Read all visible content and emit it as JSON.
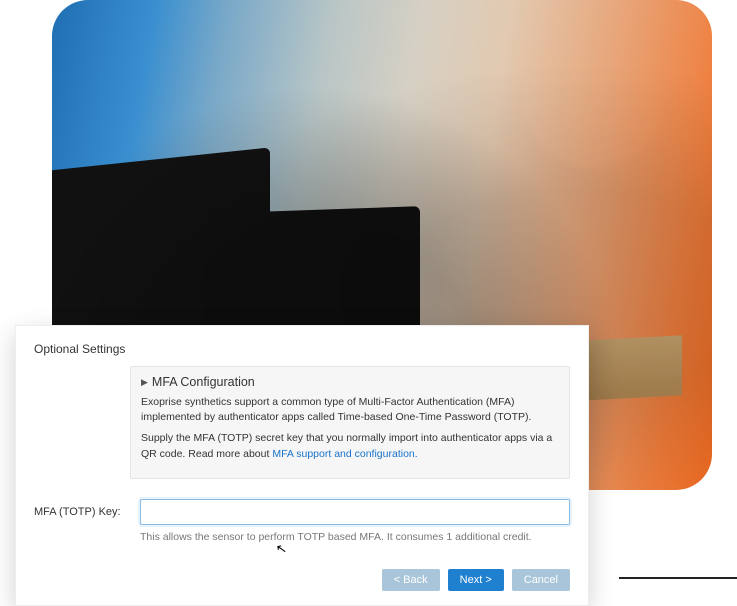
{
  "dialog": {
    "title": "Optional Settings",
    "panel": {
      "heading": "MFA Configuration",
      "para1": "Exoprise synthetics support a common type of Multi-Factor Authentication (MFA) implemented by authenticator apps called Time-based One-Time Password (TOTP).",
      "para2_pre": "Supply the MFA (TOTP) secret key that you normally import into authenticator apps via a QR code. Read more about ",
      "para2_link": "MFA support and configuration.",
      "link_href": "#"
    },
    "field": {
      "label": "MFA (TOTP) Key:",
      "value": "",
      "placeholder": ""
    },
    "hint": "This allows the sensor to perform TOTP based MFA. It consumes 1 additional credit.",
    "buttons": {
      "back": "< Back",
      "next": "Next >",
      "cancel": "Cancel"
    }
  }
}
